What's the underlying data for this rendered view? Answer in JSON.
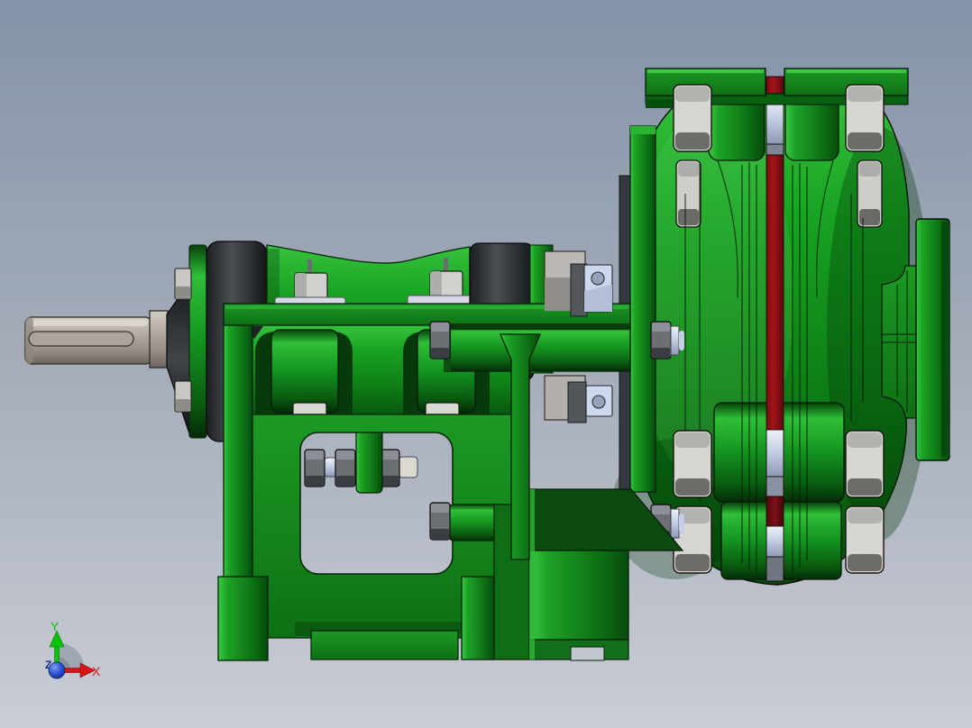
{
  "viewport": {
    "type": "3d-cad-shaded-view",
    "description": "Side view of a green horizontal centrifugal slurry pump assembly: drive shaft with keyway, bearing housing on a green support frame, bolted volute casing with red parting-line gasket, top discharge flange and right suction flange.",
    "background_top_color": "#8493a9",
    "background_bottom_color": "#c9cdd5"
  },
  "axis_triad": {
    "x_label": "X",
    "y_label": "Y",
    "z_label": "Z",
    "x_color": "#d51616",
    "y_color": "#0bc20b",
    "z_color": "#1b2a8a",
    "origin_sphere_color": "#2c50cf",
    "quadrant_color": "#9ba3af"
  },
  "model": {
    "parts": [
      {
        "name": "drive-shaft",
        "color": "#b7b1a9"
      },
      {
        "name": "shaft-keyway",
        "color": "#aaa49c"
      },
      {
        "name": "bearing-seal-caps",
        "color": "#2a2d30"
      },
      {
        "name": "bearing-housing",
        "color": "#149320"
      },
      {
        "name": "housing-hex-bolts",
        "color": "#d2d1ce"
      },
      {
        "name": "support-frame",
        "color": "#17961f"
      },
      {
        "name": "adjusting-rod-nuts",
        "color": "#6c7075"
      },
      {
        "name": "pump-casing",
        "color": "#128a1a"
      },
      {
        "name": "casing-gasket-parting-line",
        "color": "#a41419"
      },
      {
        "name": "casing-stud-sleeves",
        "color": "#c6cfe4"
      },
      {
        "name": "casing-hex-nuts",
        "color": "#d8d6d2"
      },
      {
        "name": "discharge-flange",
        "color": "#1da226"
      },
      {
        "name": "suction-flange",
        "color": "#11821a"
      },
      {
        "name": "gland-plates",
        "color": "#cdd8ee"
      }
    ]
  }
}
